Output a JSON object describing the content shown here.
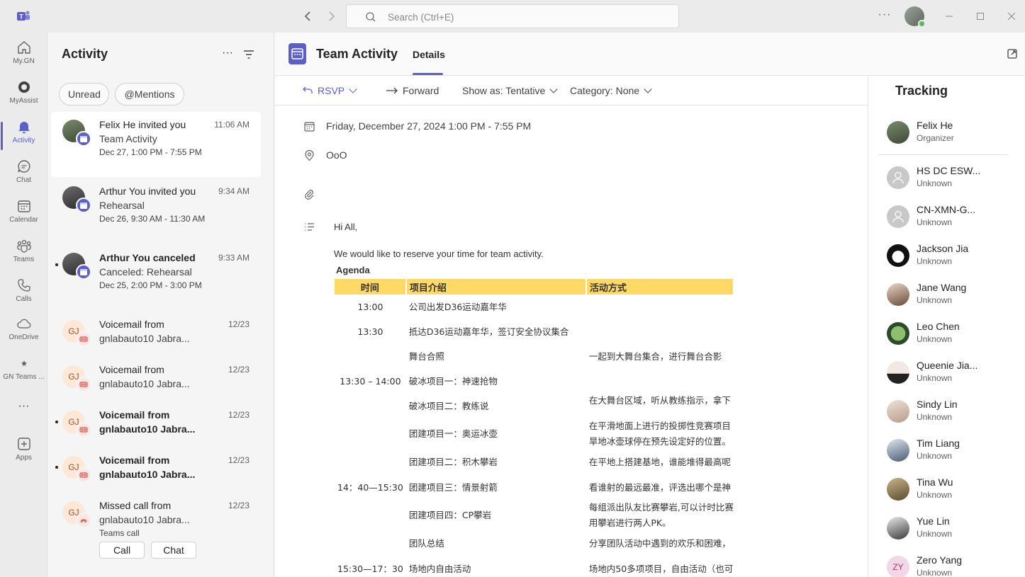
{
  "titlebar": {
    "search_placeholder": "Search (Ctrl+E)",
    "more": "···"
  },
  "rail": [
    {
      "label": "My.GN",
      "icon": "home-icon"
    },
    {
      "label": "MyAssist",
      "icon": "myassist-icon"
    },
    {
      "label": "Activity",
      "icon": "bell-icon",
      "active": true
    },
    {
      "label": "Chat",
      "icon": "chat-icon"
    },
    {
      "label": "Calendar",
      "icon": "calendar-icon"
    },
    {
      "label": "Teams",
      "icon": "teams-icon"
    },
    {
      "label": "Calls",
      "icon": "phone-icon"
    },
    {
      "label": "OneDrive",
      "icon": "cloud-icon"
    },
    {
      "label": "GN Teams ...",
      "icon": "star-icon"
    },
    {
      "label": "···",
      "icon": "more-icon"
    },
    {
      "label": "Apps",
      "icon": "apps-icon"
    }
  ],
  "activity": {
    "title": "Activity",
    "more": "···",
    "filters": [
      "Unread",
      "@Mentions"
    ],
    "items": [
      {
        "line1": "Felix He invited you",
        "line2": "Team Activity",
        "line3": "Dec 27, 1:00 PM - 7:55 PM",
        "time": "11:06 AM"
      },
      {
        "line1": "Arthur You invited you",
        "line2": "Rehearsal",
        "line3": "Dec 26, 9:30 AM - 11:30 AM",
        "time": "9:34 AM"
      },
      {
        "line1": "Arthur You canceled",
        "line2": "Canceled: Rehearsal",
        "line3": "Dec 25, 2:00 PM - 3:00 PM",
        "time": "9:33 AM"
      },
      {
        "initials": "GJ",
        "line1": "Voicemail from",
        "line2": "gnlabauto10 Jabra...",
        "time": "12/23"
      },
      {
        "initials": "GJ",
        "line1": "Voicemail from",
        "line2": "gnlabauto10 Jabra...",
        "time": "12/23"
      },
      {
        "initials": "GJ",
        "line1": "Voicemail from",
        "line2": "gnlabauto10 Jabra...",
        "time": "12/23"
      },
      {
        "initials": "GJ",
        "line1": "Voicemail from",
        "line2": "gnlabauto10 Jabra...",
        "time": "12/23"
      },
      {
        "initials": "GJ",
        "line1": "Missed call from",
        "line2": "gnlabauto10 Jabra...",
        "line3": "Teams call",
        "time": "12/23",
        "btn_call": "Call",
        "btn_chat": "Chat"
      }
    ]
  },
  "main": {
    "title": "Team Activity",
    "tab": "Details",
    "toolbar": {
      "rsvp": "RSVP",
      "forward": "Forward",
      "show_as": "Show as: Tentative",
      "category": "Category: None"
    },
    "datetime": "Friday, December 27, 2024 1:00 PM - 7:55 PM",
    "location": "OoO",
    "body": {
      "greeting": "Hi All,",
      "intro": "We would like to reserve your time for team activity.",
      "agenda_label": "Agenda",
      "headers": [
        "时间",
        "项目介绍",
        "活动方式"
      ],
      "rows": [
        {
          "time": "13:00",
          "item": "公司出发D36运动嘉年华",
          "mode": ""
        },
        {
          "time": "13:30",
          "item": "抵达D36运动嘉年华，签订安全协议集合",
          "mode": ""
        },
        {
          "time": "",
          "item": "舞台合照",
          "mode": "一起到大舞台集合，进行舞台合影"
        },
        {
          "time": "13:30 – 14:00",
          "item": "破冰项目一：神速抢物",
          "mode": ""
        },
        {
          "time": "",
          "item": "破冰项目二：教练说",
          "mode": "在大舞台区域，听从教练指示，拿下"
        },
        {
          "time": "",
          "item": "团建项目一：奥运冰壶",
          "mode": "在平滑地面上进行的投掷性竞赛项目"
        },
        {
          "time": "",
          "item": "",
          "mode": "旱地冰壶球停在预先设定好的位置。"
        },
        {
          "time": "",
          "item": "团建项目二：积木攀岩",
          "mode": "在平地上搭建基地，谁能堆得最高呢"
        },
        {
          "time": "14：40—15:30",
          "item": "团建项目三：情景射箭",
          "mode": "看谁射的最远最准，评选出哪个是神"
        },
        {
          "time": "",
          "item": "团建项目四：CP攀岩",
          "mode": "每组派出队友比赛攀岩,可以计时比赛"
        },
        {
          "time": "",
          "item": "",
          "mode": "用攀岩进行两人PK。"
        },
        {
          "time": "",
          "item": "团队总结",
          "mode": "分享团队活动中遇到的欢乐和困难，"
        },
        {
          "time": "15:30—17：30",
          "item": "场地内自由活动",
          "mode": "场地内50多项项目，自由活动（也可"
        }
      ]
    }
  },
  "tracking": {
    "title": "Tracking",
    "organizer": {
      "name": "Felix He",
      "role": "Organizer"
    },
    "attendees": [
      {
        "name": "HS DC ESW...",
        "status": "Unknown"
      },
      {
        "name": "CN-XMN-G...",
        "status": "Unknown"
      },
      {
        "name": "Jackson Jia",
        "status": "Unknown"
      },
      {
        "name": "Jane Wang",
        "status": "Unknown"
      },
      {
        "name": "Leo Chen",
        "status": "Unknown"
      },
      {
        "name": "Queenie Jia...",
        "status": "Unknown"
      },
      {
        "name": "Sindy Lin",
        "status": "Unknown"
      },
      {
        "name": "Tim Liang",
        "status": "Unknown"
      },
      {
        "name": "Tina Wu",
        "status": "Unknown"
      },
      {
        "name": "Yue Lin",
        "status": "Unknown"
      },
      {
        "name": "Zero Yang",
        "status": "Unknown",
        "initials": "ZY"
      }
    ]
  },
  "colors": {
    "accent": "#5b5fc7",
    "agenda_header": "#ffd966"
  }
}
